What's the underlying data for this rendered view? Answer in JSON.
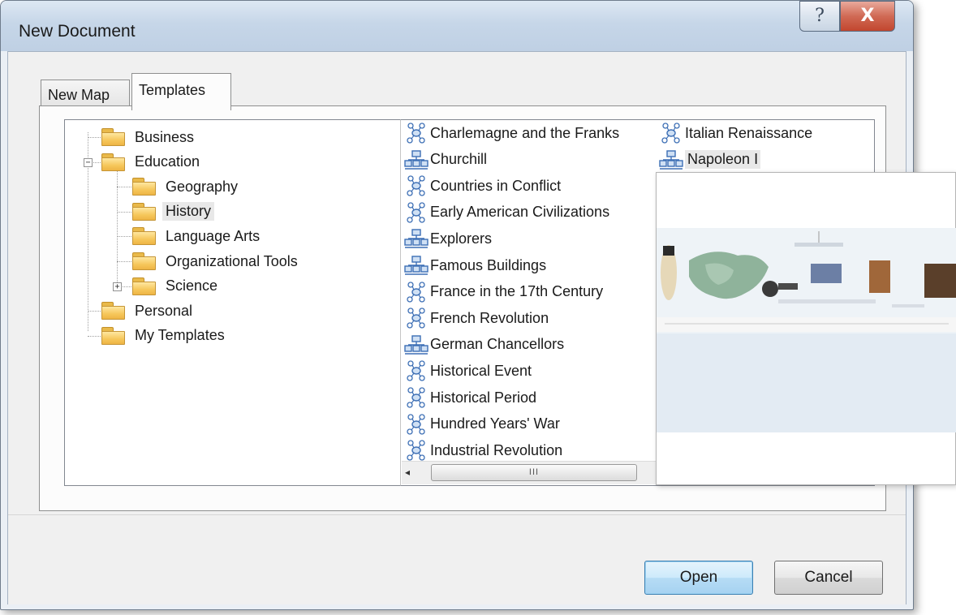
{
  "window": {
    "title": "New Document",
    "help_glyph": "?",
    "close_glyph": "X"
  },
  "tabs": [
    {
      "label": "New Map",
      "selected": false
    },
    {
      "label": "Templates",
      "selected": true
    }
  ],
  "tree": {
    "items": [
      {
        "label": "Business",
        "level": 0,
        "expander": ""
      },
      {
        "label": "Education",
        "level": 0,
        "expander": "−"
      },
      {
        "label": "Geography",
        "level": 1,
        "expander": ""
      },
      {
        "label": "History",
        "level": 1,
        "expander": "",
        "selected": true
      },
      {
        "label": "Language Arts",
        "level": 1,
        "expander": ""
      },
      {
        "label": "Organizational Tools",
        "level": 1,
        "expander": ""
      },
      {
        "label": "Science",
        "level": 1,
        "expander": "+"
      },
      {
        "label": "Personal",
        "level": 0,
        "expander": ""
      },
      {
        "label": "My Templates",
        "level": 0,
        "expander": ""
      }
    ]
  },
  "templates": {
    "column1": [
      {
        "label": "Charlemagne and the Franks",
        "icon": "mind-map-icon"
      },
      {
        "label": "Churchill",
        "icon": "org-chart-icon"
      },
      {
        "label": "Countries in Conflict",
        "icon": "mind-map-icon"
      },
      {
        "label": "Early American Civilizations",
        "icon": "mind-map-icon"
      },
      {
        "label": "Explorers",
        "icon": "org-chart-icon"
      },
      {
        "label": "Famous Buildings",
        "icon": "org-chart-icon"
      },
      {
        "label": "France in the 17th Century",
        "icon": "mind-map-icon"
      },
      {
        "label": "French Revolution",
        "icon": "mind-map-icon"
      },
      {
        "label": "German Chancellors",
        "icon": "org-chart-icon"
      },
      {
        "label": "Historical Event",
        "icon": "mind-map-icon"
      },
      {
        "label": "Historical Period",
        "icon": "mind-map-icon"
      },
      {
        "label": "Hundred Years' War",
        "icon": "mind-map-icon"
      },
      {
        "label": "Industrial Revolution",
        "icon": "mind-map-icon"
      }
    ],
    "column2": [
      {
        "label": "Italian Renaissance",
        "icon": "mind-map-icon"
      },
      {
        "label": "Napoleon I",
        "icon": "org-chart-icon",
        "selected": true
      }
    ]
  },
  "scrollbar": {
    "thumb_grip": "III",
    "left_arrow": "◂"
  },
  "buttons": {
    "open": "Open",
    "cancel": "Cancel"
  },
  "colors": {
    "accent": "#3c7fb1",
    "titlebar": "#c6d6e8",
    "close": "#c2462e"
  }
}
